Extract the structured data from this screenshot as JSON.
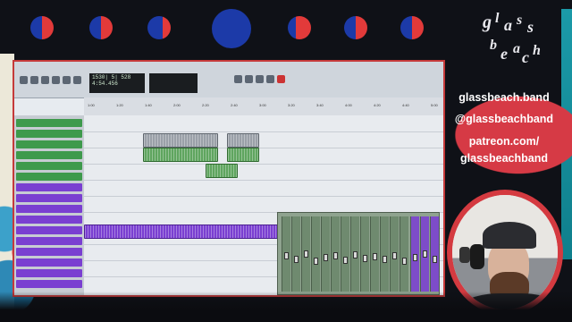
{
  "links": {
    "website": "glassbeach.band",
    "handle": "@glassbeachband",
    "patreon_line1": "patreon.com/",
    "patreon_line2": "glassbeachband"
  },
  "logo": {
    "letters": [
      "g",
      "l",
      "a",
      "s",
      "s",
      "b",
      "e",
      "a",
      "c",
      "h"
    ]
  },
  "daw": {
    "counter_main": "1530| 5| 528",
    "counter_sub": "4:54.456",
    "ruler_ticks": [
      "1:00",
      "1:20",
      "1:40",
      "2:00",
      "2:20",
      "2:40",
      "3:00",
      "3:20",
      "3:40",
      "4:00",
      "4:20",
      "4:40",
      "5:00"
    ]
  },
  "colors": {
    "moon_blue": "#1c3aa8",
    "moon_red": "#e23a3a",
    "accent_red": "#d63a45",
    "teal": "#1b9aa8"
  }
}
